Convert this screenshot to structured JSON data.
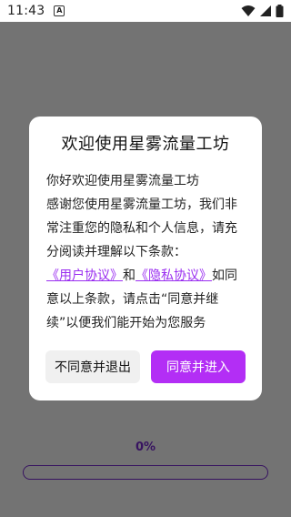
{
  "status_bar": {
    "time": "11:43",
    "notification_icon": "A"
  },
  "progress": {
    "label": "0%",
    "value": 0
  },
  "dialog": {
    "title": "欢迎使用星雾流量工坊",
    "greeting": "你好欢迎使用星雾流量工坊",
    "line1": "感谢您使用星雾流量工坊，我们非常注重您的隐私和个人信息，请充分阅读并理解以下条款：",
    "link_user": "《用户协议》",
    "and": "和",
    "link_privacy": "《隐私协议》",
    "line2_tail": "如同意以上条款，请点击“同意并继续”以便我们能开始为您服务",
    "btn_disagree": "不同意并退出",
    "btn_agree": "同意并进入"
  },
  "colors": {
    "accent": "#b32ef5",
    "progress": "#7a2bd6",
    "link": "#9a2ef0"
  }
}
